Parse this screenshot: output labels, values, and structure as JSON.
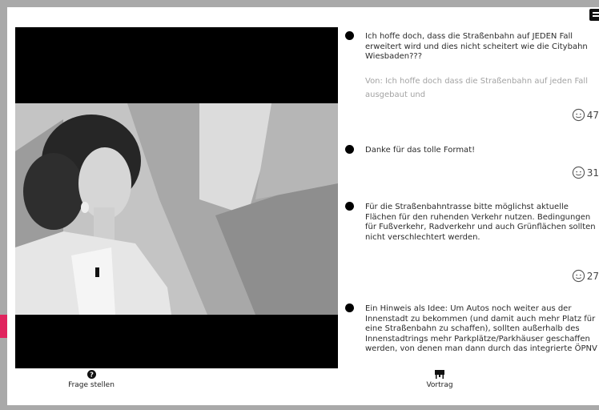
{
  "comments": [
    {
      "text": "Ich hoffe doch, dass die Straßenbahn auf JEDEN Fall erweitert wird und dies nicht scheitert wie die Citybahn Wiesbaden???",
      "from": "Von: Ich hoffe doch dass die Straßenbahn auf jeden Fall ausgebaut und",
      "likes": "47"
    },
    {
      "text": "Danke für das tolle Format!",
      "likes": "31"
    },
    {
      "text": "Für die Straßenbahntrasse bitte möglichst aktuelle Flächen für den ruhenden Verkehr nutzen. Bedingungen für Fußverkehr, Radverkehr und auch Grünflächen sollten nicht verschlechtert werden.",
      "likes": "27"
    },
    {
      "text": "Ein Hinweis als Idee: Um Autos noch weiter aus der Innenstadt zu bekommen (und damit auch mehr Platz für eine Straßenbahn zu schaffen), sollten außerhalb des Innenstadtrings mehr Parkplätze/Parkhäuser geschaffen werden, von denen man dann durch das integrierte ÖPNV"
    }
  ],
  "nav": {
    "ask_label": "Frage stellen",
    "ask_icon": "question-circle-icon",
    "talk_label": "Vortrag",
    "talk_icon": "presentation-icon"
  },
  "colors": {
    "accent": "#e0245e",
    "background": "#a9a9a9"
  }
}
